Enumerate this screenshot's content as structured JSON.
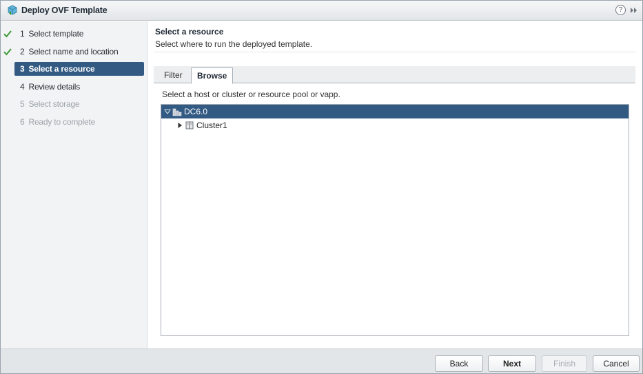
{
  "window": {
    "title": "Deploy OVF Template",
    "help_glyph": "?",
    "icons": {
      "app": "ovf-template-icon",
      "help": "help-icon",
      "collapse": "double-chevron-right-icon"
    }
  },
  "steps": [
    {
      "num": "1",
      "label": "Select template",
      "state": "done"
    },
    {
      "num": "2",
      "label": "Select name and location",
      "state": "done"
    },
    {
      "num": "3",
      "label": "Select a resource",
      "state": "active"
    },
    {
      "num": "4",
      "label": "Review details",
      "state": "todo"
    },
    {
      "num": "5",
      "label": "Select storage",
      "state": "disabled"
    },
    {
      "num": "6",
      "label": "Ready to complete",
      "state": "disabled"
    }
  ],
  "main": {
    "heading": "Select a resource",
    "subheading": "Select where to run the deployed template.",
    "tabs": {
      "filter": "Filter",
      "browse": "Browse",
      "active": "Browse"
    },
    "instruction": "Select a host or cluster or resource pool or vapp.",
    "tree": [
      {
        "label": "DC6.0",
        "icon": "datacenter-icon",
        "expanded": true,
        "selected": true
      },
      {
        "label": "Cluster1",
        "icon": "cluster-icon",
        "expanded": false,
        "selected": false
      }
    ]
  },
  "footer": {
    "back": "Back",
    "next": "Next",
    "finish": "Finish",
    "cancel": "Cancel"
  },
  "colors": {
    "accent": "#325a83",
    "check": "#3d9b35"
  }
}
